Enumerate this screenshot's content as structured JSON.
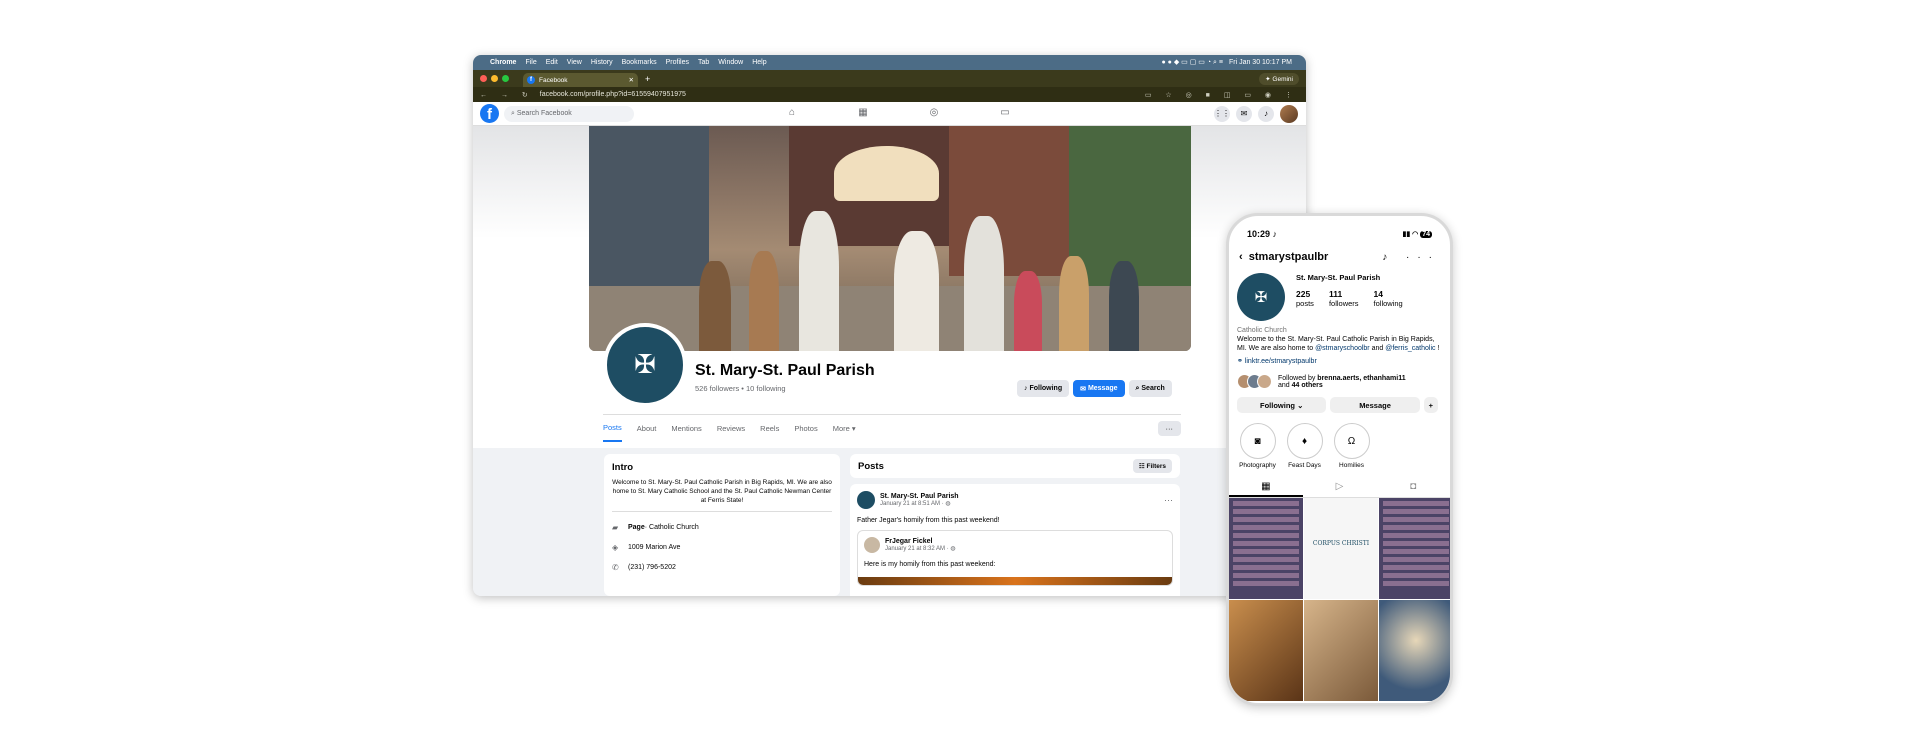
{
  "mac": {
    "menu": [
      "Chrome",
      "File",
      "Edit",
      "View",
      "History",
      "Bookmarks",
      "Profiles",
      "Tab",
      "Window",
      "Help"
    ],
    "datetime": "Fri Jan 30  10:17 PM"
  },
  "browser": {
    "tab_title": "Facebook",
    "gemini": "Gemini",
    "url": "facebook.com/profile.php?id=61559407951975"
  },
  "facebook": {
    "search_placeholder": "Search Facebook",
    "page_name": "St. Mary-St. Paul Parish",
    "stats": "526 followers • 10 following",
    "buttons": {
      "following": "Following",
      "message": "Message",
      "search": "Search"
    },
    "tabs": [
      "Posts",
      "About",
      "Mentions",
      "Reviews",
      "Reels",
      "Photos",
      "More ▾"
    ],
    "intro": {
      "title": "Intro",
      "description": "Welcome to St. Mary-St. Paul Catholic Parish in Big Rapids, MI. We are also home to St. Mary Catholic School and the St. Paul Catholic Newman Center at Ferris State!",
      "category_bold": "Page",
      "category": " · Catholic Church",
      "address": "1009 Marion Ave",
      "phone": "(231) 796-5202"
    },
    "posts_title": "Posts",
    "filters": "Filters",
    "post": {
      "author": "St. Mary-St. Paul Parish",
      "date": "January 21 at 8:51 AM · ",
      "text": "Father Jegar's homily from this past weekend!",
      "shared_author": "FrJegar Fickel",
      "shared_date": "January 21 at 8:32 AM · ",
      "shared_text": "Here is my homily from this past weekend:"
    }
  },
  "instagram": {
    "time": "10:29",
    "battery": "74",
    "username": "stmarystpaulbr",
    "name": "St. Mary-St. Paul Parish",
    "posts": "225",
    "posts_label": "posts",
    "followers": "111",
    "followers_label": "followers",
    "following": "14",
    "following_label": "following",
    "category": "Catholic Church",
    "bio_1": "Welcome to the St. Mary-St. Paul Catholic Parish in Big Rapids, MI. We are also home to ",
    "bio_link1": "@stmaryschoolbr",
    "bio_2": " and ",
    "bio_link2": "@ferris_catholic",
    "bio_3": " !",
    "link": "linktr.ee/stmarystpaulbr",
    "followed_by": "Followed by ",
    "followed_names": "brenna.aerts, ethanhami11",
    "followed_and": " and ",
    "followed_others": "44 others",
    "btn_following": "Following ⌄",
    "btn_message": "Message",
    "highlights": [
      "Photography",
      "Feast Days",
      "Homilies"
    ],
    "grid_text": "CORPUS CHRISTI"
  }
}
